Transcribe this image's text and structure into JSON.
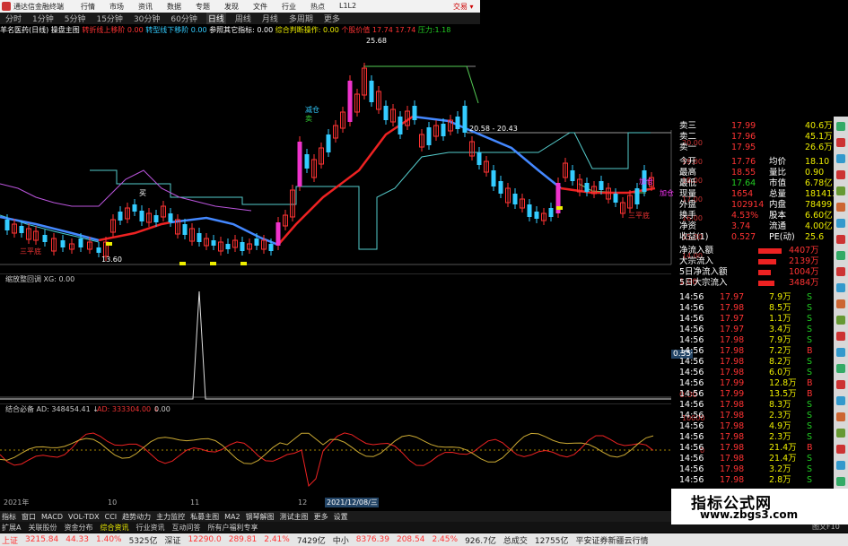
{
  "app": {
    "title": "通达信金融终端",
    "trade_label": "交易 ▾"
  },
  "menu": [
    "行情",
    "市场",
    "资讯",
    "数据",
    "专题",
    "发现",
    "文件",
    "行业",
    "热点",
    "L1L2"
  ],
  "period_tabs": [
    "分时",
    "1分钟",
    "5分钟",
    "15分钟",
    "30分钟",
    "60分钟",
    "日线",
    "周线",
    "月线",
    "多周期",
    "更多"
  ],
  "info_bar": {
    "stock": "羊名医药(日线)",
    "i1": "操盘主图",
    "i2": "转折线上移阶",
    "i3": "0.00",
    "i4": "转型线下移阶",
    "i5": "0.00",
    "i6": "参照其它指标:",
    "i7": "0.00",
    "i8": "综合判断操作:",
    "i9": "0.00",
    "i10": "个股价值",
    "i11": "17.74",
    "i12": "17.74",
    "i13": "压力:1.18"
  },
  "main_labels": {
    "high": "25.68",
    "mid": "20.58 - 20.43",
    "low": "13.60",
    "tag1": "三平底",
    "tag2": "三平底",
    "tag3": "加仓",
    "tag4": "加仓",
    "tag5": "减仓",
    "tag6": "买",
    "tag7": "卖"
  },
  "ind1": {
    "title": "缩放整回调 XG: 0.00",
    "v1": "1.00",
    "v2": "0.35",
    "v3": "0.00"
  },
  "ind2": {
    "title": "结合必备 AD: 348454.41 ↓",
    "ad2": "AD: 333304.00 ↓",
    "v": "0.00",
    "y1": "10000",
    "y2": "0"
  },
  "x_axis": {
    "x1": "2021年",
    "x2": "10",
    "x3": "11",
    "x4": "12",
    "date": "2021/12/08/三"
  },
  "y_axis": [
    "20.00",
    "19.00",
    "18.00",
    "17.00",
    "16.00",
    "15.00",
    "14.00"
  ],
  "quote": {
    "sells": [
      {
        "l": "卖三",
        "p": "17.99",
        "v": "40.6万"
      },
      {
        "l": "卖二",
        "p": "17.96",
        "v": "45.1万"
      },
      {
        "l": "卖一",
        "p": "17.95",
        "v": "26.6万"
      }
    ],
    "stats": [
      {
        "a": "今开",
        "b": "17.76",
        "c": "均价",
        "d": "18.10"
      },
      {
        "a": "最高",
        "b": "18.55",
        "c": "量比",
        "d": "0.90"
      },
      {
        "a": "最低",
        "b": "17.64",
        "c": "市值",
        "d": "6.78亿"
      },
      {
        "a": "现量",
        "b": "1654",
        "c": "总量",
        "d": "181413"
      },
      {
        "a": "外盘",
        "b": "102914",
        "c": "内盘",
        "d": "78499"
      },
      {
        "a": "换手",
        "b": "4.53%",
        "c": "股本",
        "d": "6.60亿"
      },
      {
        "a": "净资",
        "b": "3.74",
        "c": "流通",
        "d": "4.00亿"
      },
      {
        "a": "收益(1)",
        "b": "0.527",
        "c": "PE(动)",
        "d": "25.6"
      }
    ],
    "flows": [
      {
        "l": "净流入额",
        "v": "4407万"
      },
      {
        "l": "大宗流入",
        "v": "2139万"
      },
      {
        "l": "5日净流入额",
        "v": "1004万"
      },
      {
        "l": "5日大宗流入",
        "v": "3484万"
      }
    ],
    "ticks": [
      {
        "t": "14:56",
        "p": "17.97",
        "v": "7.9万",
        "s": "S"
      },
      {
        "t": "14:56",
        "p": "17.98",
        "v": "8.5万",
        "s": "S"
      },
      {
        "t": "14:56",
        "p": "17.97",
        "v": "1.1万",
        "s": "S"
      },
      {
        "t": "14:56",
        "p": "17.97",
        "v": "3.4万",
        "s": "S"
      },
      {
        "t": "14:56",
        "p": "17.98",
        "v": "7.9万",
        "s": "S"
      },
      {
        "t": "14:56",
        "p": "17.98",
        "v": "7.2万",
        "s": "B"
      },
      {
        "t": "14:56",
        "p": "17.98",
        "v": "8.2万",
        "s": "S"
      },
      {
        "t": "14:56",
        "p": "17.98",
        "v": "6.0万",
        "s": "S"
      },
      {
        "t": "14:56",
        "p": "17.99",
        "v": "12.8万",
        "s": "B"
      },
      {
        "t": "14:56",
        "p": "17.99",
        "v": "13.5万",
        "s": "B"
      },
      {
        "t": "14:56",
        "p": "17.98",
        "v": "8.3万",
        "s": "S"
      },
      {
        "t": "14:56",
        "p": "17.98",
        "v": "2.3万",
        "s": "S"
      },
      {
        "t": "14:56",
        "p": "17.98",
        "v": "4.9万",
        "s": "S"
      },
      {
        "t": "14:56",
        "p": "17.98",
        "v": "2.3万",
        "s": "S"
      },
      {
        "t": "14:56",
        "p": "17.98",
        "v": "21.4万",
        "s": "B"
      },
      {
        "t": "14:56",
        "p": "17.98",
        "v": "21.4万",
        "s": "S"
      },
      {
        "t": "14:56",
        "p": "17.98",
        "v": "3.2万",
        "s": "S"
      },
      {
        "t": "14:56",
        "p": "17.98",
        "v": "2.8万",
        "s": "S"
      }
    ]
  },
  "bottom_tabs": [
    "指标",
    "窗口",
    "MACD",
    "VOL-TDX",
    "CCI",
    "趋势动力",
    "主力监控",
    "私募主图",
    "MA2",
    "钢琴解图",
    "测试主图",
    "更多",
    "设置"
  ],
  "bottom_tabs2": [
    "扩展A",
    "关联股份",
    "资金分布",
    "综合资讯",
    "行业资讯",
    "互动问答",
    "所有户福利专享"
  ],
  "status": {
    "sh": "上证",
    "sh_v": "3215.84",
    "sh_c": "44.33",
    "sh_p": "1.40%",
    "sh_a": "5325亿",
    "sz": "深证",
    "sz_v": "12290.0",
    "sz_c": "289.81",
    "sz_p": "2.41%",
    "sz_a": "7429亿",
    "zx": "中小",
    "zx_v": "8376.39",
    "zx_c": "208.54",
    "zx_p": "2.45%",
    "zx_a": "926.7亿",
    "total": "总成交",
    "total_v": "12755亿",
    "news": "平安证券新疆云行情"
  },
  "watermark": {
    "line1": "指标公式网",
    "line2": "www.zbgs3.com"
  },
  "side_label": "图文F10"
}
